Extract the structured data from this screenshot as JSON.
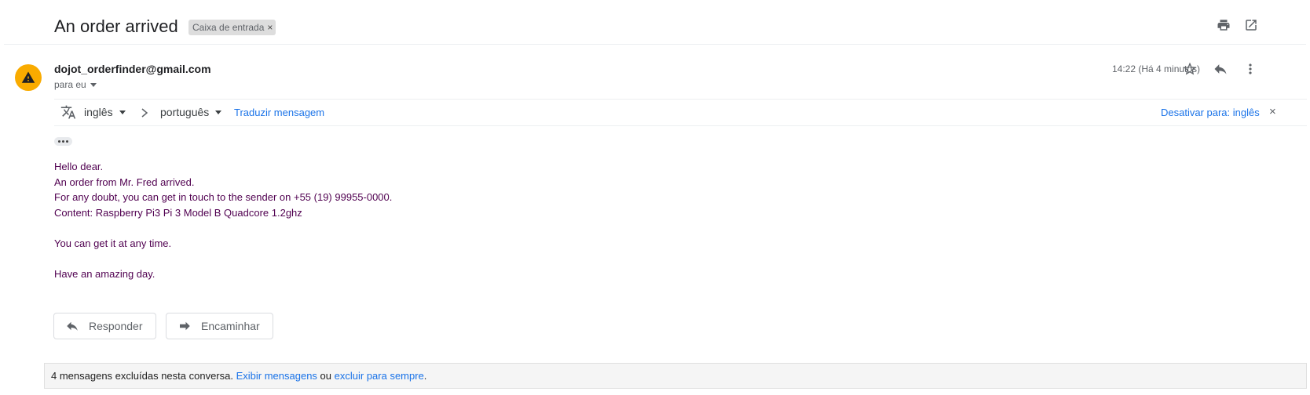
{
  "header": {
    "subject": "An order arrived",
    "label_chip": "Caixa de entrada",
    "label_remove": "×",
    "print_icon": "print-icon",
    "popout_icon": "open-in-new-window-icon"
  },
  "message": {
    "sender_email": "dojot_orderfinder@gmail.com",
    "recipient": "para eu",
    "timestamp": "14:22 (Há 4 minutos)",
    "avatar_icon": "warning-icon",
    "avatar_color": "#f9ab00",
    "actions": [
      "star-icon",
      "reply-icon",
      "more-vert-icon"
    ]
  },
  "translate": {
    "source_lang": "inglês",
    "target_lang": "português",
    "translate_link": "Traduzir mensagem",
    "disable_link": "Desativar para: inglês",
    "close": "×"
  },
  "body": {
    "lines": [
      "Hello dear.",
      "An order from Mr. Fred arrived.",
      "For any doubt, you can get in touch to the sender on +55 (19) 99955-0000.",
      "Content: Raspberry Pi3 Pi 3 Model B Quadcore 1.2ghz"
    ],
    "line_pickup": "You can get it at any time.",
    "line_closing": "Have an amazing day.",
    "text_color": "#500050"
  },
  "buttons": {
    "reply": "Responder",
    "forward": "Encaminhar"
  },
  "deleted_bar": {
    "text": "4 mensagens excluídas nesta conversa.",
    "show_link": "Exibir mensagens",
    "or": "ou",
    "delete_link": "excluir para sempre",
    "period": "."
  },
  "colors": {
    "link": "#1a73e8",
    "accent_warning": "#f9ab00"
  }
}
